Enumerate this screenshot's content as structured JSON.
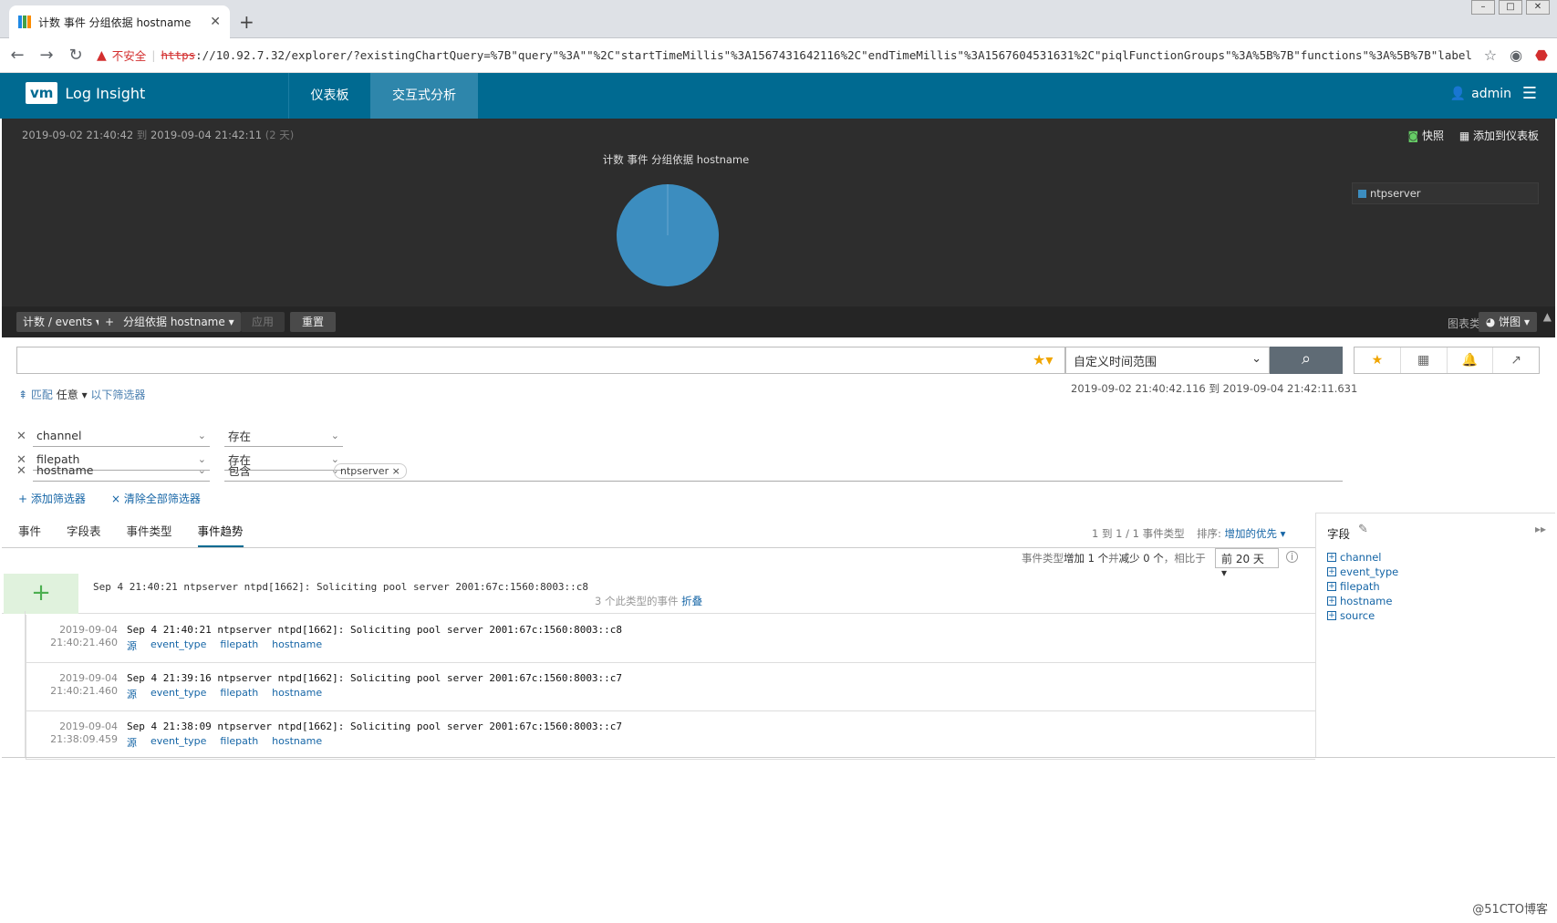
{
  "browser": {
    "tab_title": "计数 事件 分组依据 hostname",
    "new_tab": "+",
    "security_label": "不安全",
    "scheme": "https",
    "url": "://10.92.7.32/explorer/?existingChartQuery=%7B\"query\"%3A\"\"%2C\"startTimeMillis\"%3A1567431642116%2C\"endTimeMillis\"%3A1567604531631%2C\"piqlFunctionGroups\"%3A%5B%7B\"functions\"%3A%5B%7B\"label\"%3A…"
  },
  "app": {
    "logo": "vm",
    "name": "Log Insight",
    "nav": [
      "仪表板",
      "交互式分析"
    ],
    "user": "admin"
  },
  "chart_panel": {
    "start": "2019-09-02  21:40:42",
    "to": "到",
    "end": "2019-09-04  21:42:11",
    "duration": "(2 天)",
    "snapshot": "快照",
    "add_dashboard": "添加到仪表板",
    "count_btn": "计数 / events",
    "plus_btn": "+",
    "group_btn": "分组依据 hostname",
    "apply_btn": "应用",
    "reset_btn": "重置",
    "chart_type_label": "图表类型",
    "chart_type_value": "饼图"
  },
  "chart_data": {
    "type": "pie",
    "title": "计数 事件 分组依据 hostname",
    "labels": [
      "ntpserver"
    ],
    "values": [
      100
    ],
    "colors": [
      "#3c8dbf"
    ],
    "legend": "right"
  },
  "search": {
    "time_range": "自定义时间范围",
    "abs_start": "2019-09-02  21:40:42.116",
    "abs_to": "到",
    "abs_end": "2019-09-04  21:42:11.631"
  },
  "filters": {
    "match_prefix": "匹配",
    "match_mode": "任意",
    "match_suffix": "以下筛选器",
    "rows": [
      {
        "field": "channel",
        "op": "存在"
      },
      {
        "field": "filepath",
        "op": "存在"
      },
      {
        "field": "hostname",
        "op": "包含",
        "value": "ntpserver"
      }
    ],
    "add": "+ 添加筛选器",
    "clear": "× 清除全部筛选器"
  },
  "tabs": [
    "事件",
    "字段表",
    "事件类型",
    "事件趋势"
  ],
  "results": {
    "summary": "1 到 1 / 1 事件类型",
    "sort_label": "排序:",
    "sort_value": "增加的优先",
    "trend_a": "事件类型",
    "trend_b": "增加 1 个",
    "trend_c": "并",
    "trend_d": "减少 0 个",
    "trend_e": "，相比于",
    "compare": "前 20 天",
    "group_message": "Sep  4 21:40:21 ntpserver ntpd[1662]: Soliciting pool server 2001:67c:1560:8003::c8",
    "group_count": "3 个此类型的事件",
    "group_fold": "折叠",
    "events": [
      {
        "date": "2019-09-04",
        "time": "21:40:21.460",
        "msg": "Sep  4 21:40:21 ntpserver ntpd[1662]: Soliciting pool server 2001:67c:1560:8003::c8"
      },
      {
        "date": "2019-09-04",
        "time": "21:40:21.460",
        "msg": "Sep  4 21:39:16 ntpserver ntpd[1662]: Soliciting pool server 2001:67c:1560:8003::c7"
      },
      {
        "date": "2019-09-04",
        "time": "21:38:09.459",
        "msg": "Sep  4 21:38:09 ntpserver ntpd[1662]: Soliciting pool server 2001:67c:1560:8003::c7"
      }
    ],
    "event_links": [
      "源",
      "event_type",
      "filepath",
      "hostname"
    ]
  },
  "fields_panel": {
    "title": "字段",
    "items": [
      "channel",
      "event_type",
      "filepath",
      "hostname",
      "source"
    ]
  },
  "watermark": "@51CTO博客"
}
